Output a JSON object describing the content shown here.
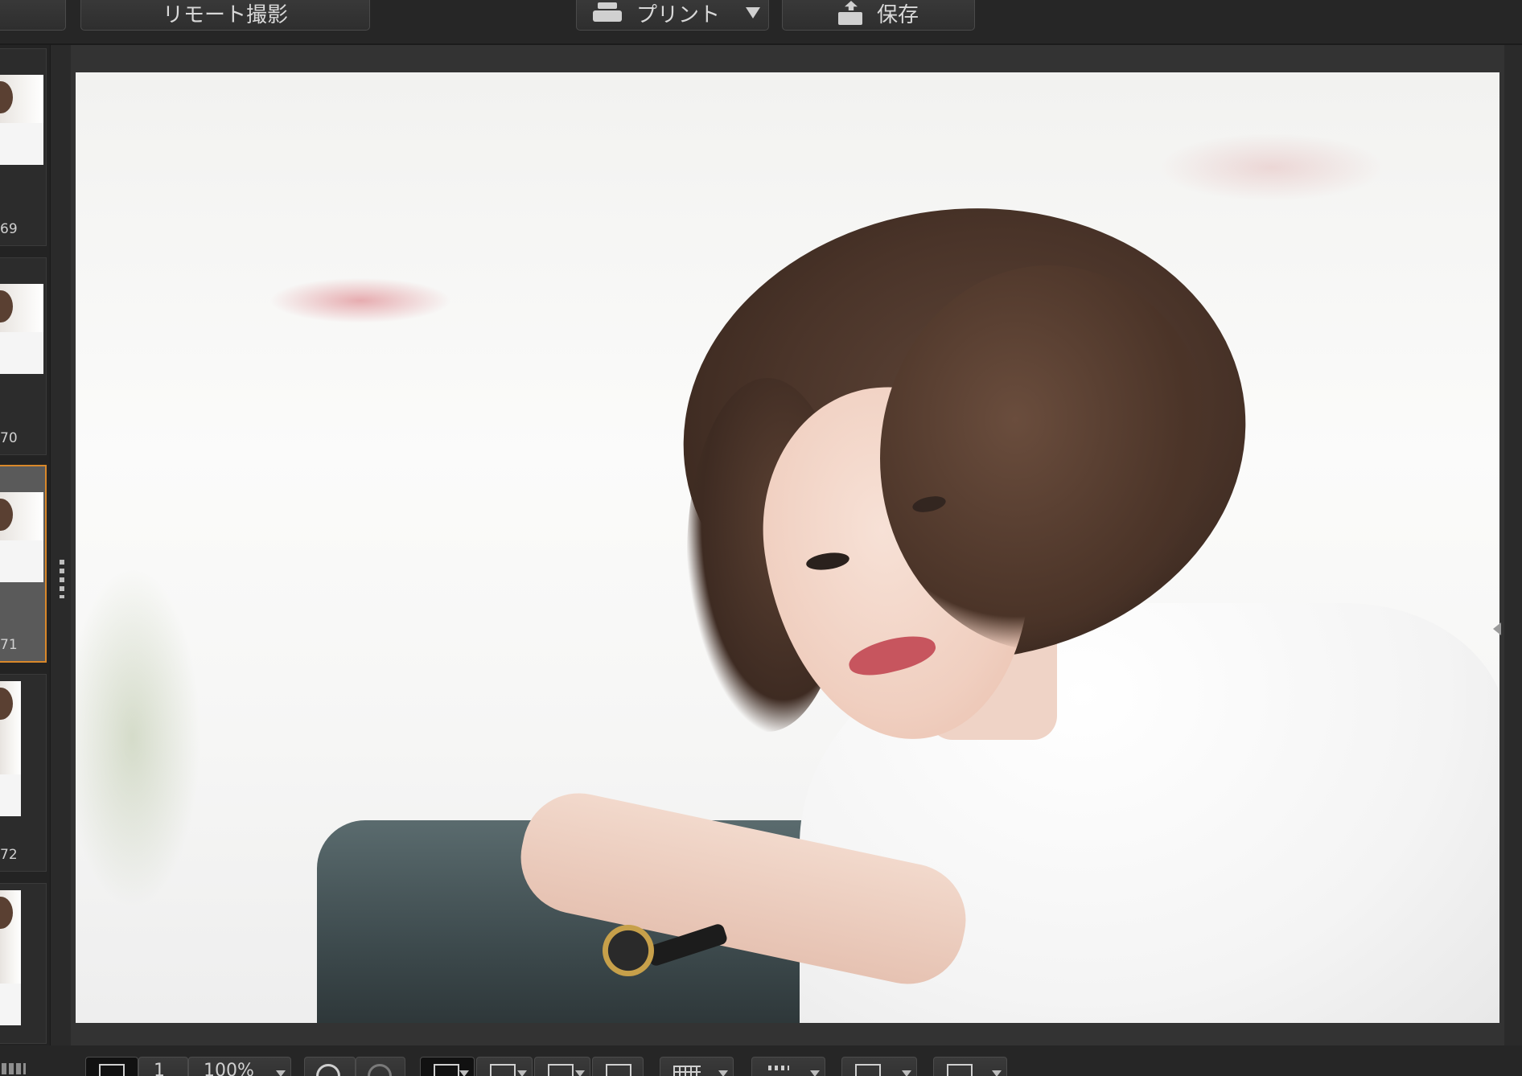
{
  "toolbar": {
    "remote_capture_label": "リモート撮影",
    "print_label": "プリント",
    "save_label": "保存"
  },
  "filmstrip": {
    "items": [
      {
        "number": "69",
        "selected": false
      },
      {
        "number": "70",
        "selected": false
      },
      {
        "number": "71",
        "selected": true
      },
      {
        "number": "72",
        "selected": false
      },
      {
        "number": "",
        "selected": false
      }
    ]
  },
  "viewer": {
    "zoom_label": "100%",
    "actual_size_label": "1"
  },
  "colors": {
    "selection_accent": "#d9882a",
    "toolbar_bg": "#262626",
    "viewer_bg": "#333333"
  }
}
